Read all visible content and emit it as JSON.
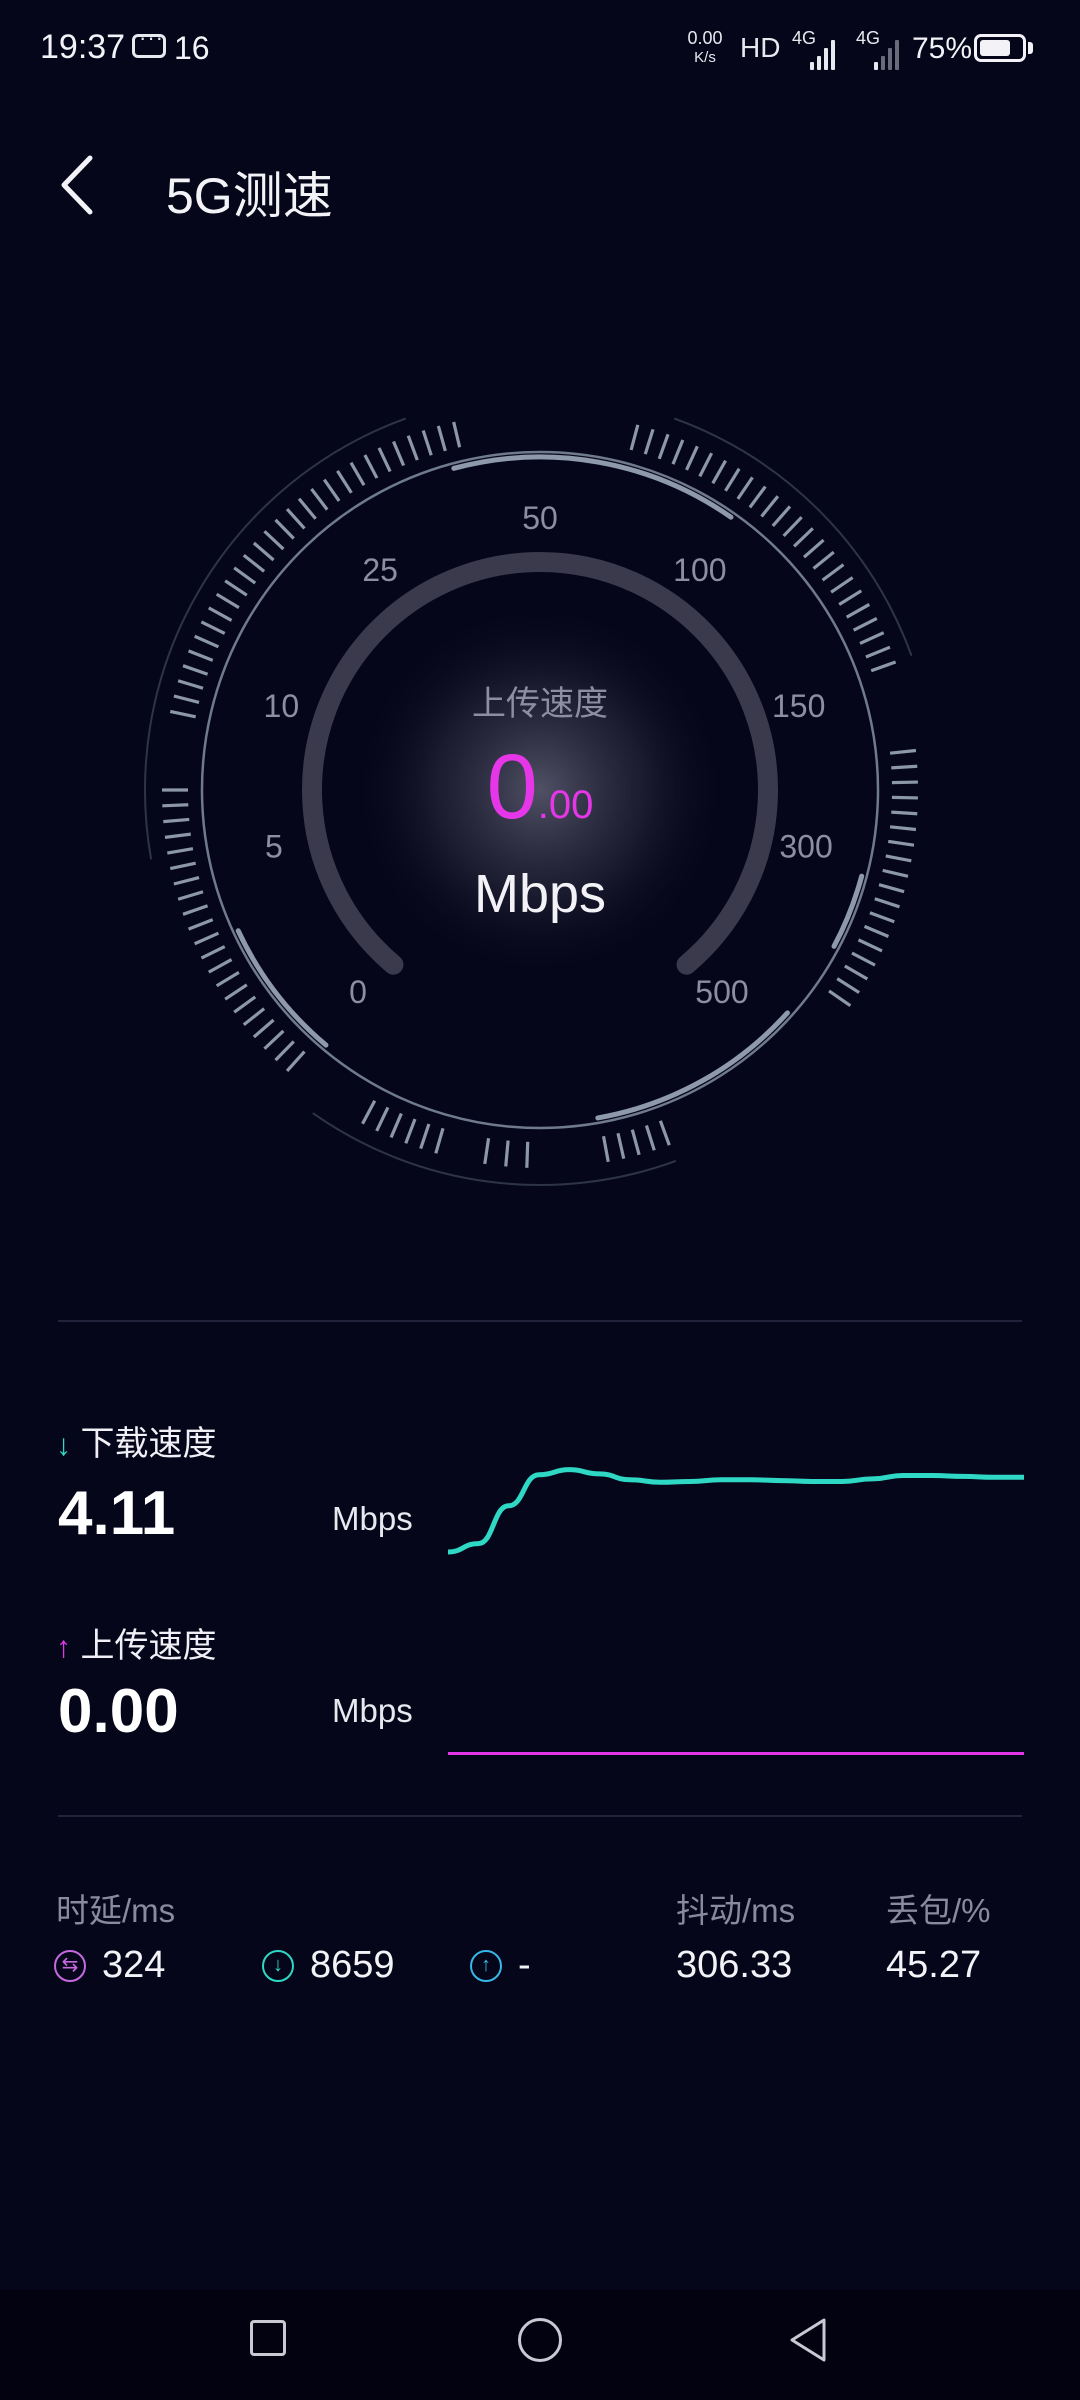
{
  "status_bar": {
    "time": "19:37",
    "notification_count": "16",
    "net_speed_value": "0.00",
    "net_speed_unit": "K/s",
    "hd_label": "HD",
    "sim1_label": "4G",
    "sim2_label": "4G",
    "battery_percent": "75%",
    "battery_level": 0.75
  },
  "header": {
    "title": "5G测速",
    "back_icon": "chevron-left-icon"
  },
  "gauge": {
    "mode_label": "上传速度",
    "value_int": "0",
    "value_dec": ".00",
    "unit": "Mbps",
    "scale_labels": [
      "0",
      "5",
      "10",
      "25",
      "50",
      "100",
      "150",
      "300",
      "500"
    ],
    "accent_color": "#e536e8"
  },
  "download": {
    "label": "下载速度",
    "value": "4.11",
    "unit": "Mbps",
    "color": "#2fd8c4",
    "sparkline": [
      0,
      0.1,
      0.55,
      0.92,
      0.98,
      0.93,
      0.86,
      0.83,
      0.84,
      0.86,
      0.86,
      0.85,
      0.84,
      0.84,
      0.87,
      0.91,
      0.91,
      0.9,
      0.89,
      0.89
    ]
  },
  "upload": {
    "label": "上传速度",
    "value": "0.00",
    "unit": "Mbps",
    "color": "#e236e8"
  },
  "metrics": {
    "latency_label": "时延/ms",
    "jitter_label": "抖动/ms",
    "loss_label": "丢包/%",
    "ping_value": "324",
    "download_latency": "8659",
    "upload_latency": "-",
    "jitter_value": "306.33",
    "loss_value": "45.27"
  },
  "navbar": {
    "recents_icon": "square-icon",
    "home_icon": "circle-icon",
    "back_icon": "triangle-back-icon"
  }
}
